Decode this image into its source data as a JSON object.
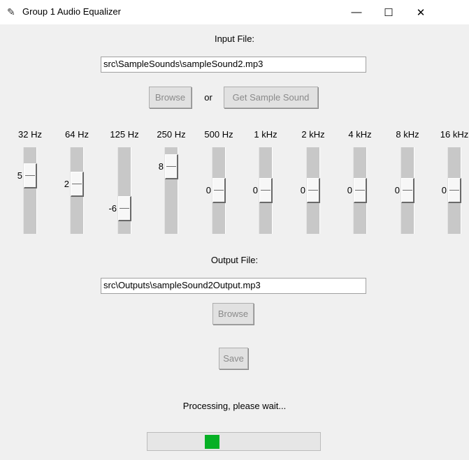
{
  "window": {
    "title": "Group 1 Audio Equalizer",
    "minimize": "—",
    "maximize": "☐",
    "close": "✕"
  },
  "input": {
    "label": "Input File:",
    "value": "src\\SampleSounds\\sampleSound2.mp3",
    "browse": "Browse",
    "or": "or",
    "sample": "Get Sample Sound"
  },
  "equalizer": {
    "range": [
      -10,
      10
    ],
    "bands": [
      {
        "label": "32 Hz",
        "value": 5
      },
      {
        "label": "64 Hz",
        "value": 2
      },
      {
        "label": "125 Hz",
        "value": -6
      },
      {
        "label": "250 Hz",
        "value": 8
      },
      {
        "label": "500 Hz",
        "value": 0
      },
      {
        "label": "1 kHz",
        "value": 0
      },
      {
        "label": "2 kHz",
        "value": 0
      },
      {
        "label": "4 kHz",
        "value": 0
      },
      {
        "label": "8 kHz",
        "value": 0
      },
      {
        "label": "16 kHz",
        "value": 0
      }
    ]
  },
  "output": {
    "label": "Output File:",
    "value": "src\\Outputs\\sampleSound2Output.mp3",
    "browse": "Browse",
    "save": "Save"
  },
  "status": {
    "text": "Processing, please wait...",
    "progress_mode": "indeterminate",
    "progress_color": "#06b025"
  }
}
